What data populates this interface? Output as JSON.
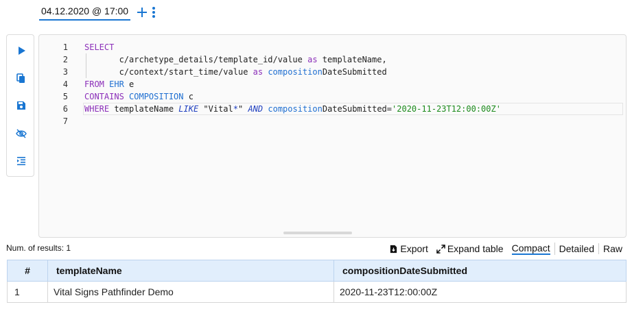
{
  "tab": {
    "label": "04.12.2020 @ 17:00"
  },
  "toolbar": {
    "icons": [
      "play-icon",
      "copy-icon",
      "save-icon",
      "eye-off-icon",
      "format-indent-icon"
    ]
  },
  "editor": {
    "line_numbers": [
      "1",
      "2",
      "3",
      "4",
      "5",
      "6",
      "7"
    ],
    "lines": [
      [
        {
          "t": "SELECT",
          "c": "kw"
        }
      ],
      [
        {
          "t": "       c/archetype_details/template_id/value ",
          "c": "plain"
        },
        {
          "t": "as",
          "c": "kw"
        },
        {
          "t": " templateName,",
          "c": "plain"
        }
      ],
      [
        {
          "t": "       c/context/start_time/value ",
          "c": "plain"
        },
        {
          "t": "as",
          "c": "kw"
        },
        {
          "t": " ",
          "c": "plain"
        },
        {
          "t": "composition",
          "c": "kwb"
        },
        {
          "t": "DateSubmitted",
          "c": "plain"
        }
      ],
      [
        {
          "t": "FROM",
          "c": "kw"
        },
        {
          "t": " ",
          "c": "plain"
        },
        {
          "t": "EHR",
          "c": "kwb"
        },
        {
          "t": " e",
          "c": "plain"
        }
      ],
      [
        {
          "t": "CONTAINS",
          "c": "kw"
        },
        {
          "t": " ",
          "c": "plain"
        },
        {
          "t": "COMPOSITION",
          "c": "kwb"
        },
        {
          "t": " c",
          "c": "plain"
        }
      ],
      [
        {
          "t": "WHERE",
          "c": "kw"
        },
        {
          "t": " templateName ",
          "c": "plain"
        },
        {
          "t": "LIKE",
          "c": "op"
        },
        {
          "t": " \"Vital",
          "c": "plain"
        },
        {
          "t": "*",
          "c": "op"
        },
        {
          "t": "\" ",
          "c": "plain"
        },
        {
          "t": "AND",
          "c": "op"
        },
        {
          "t": " ",
          "c": "plain"
        },
        {
          "t": "composition",
          "c": "kwb"
        },
        {
          "t": "DateSubmitted=",
          "c": "plain"
        },
        {
          "t": "'2020-11-23T12:00:00Z'",
          "c": "str"
        }
      ],
      []
    ]
  },
  "results": {
    "count_label": "Num. of results: 1",
    "actions": {
      "export": "Export",
      "expand": "Expand table",
      "compact": "Compact",
      "detailed": "Detailed",
      "raw": "Raw"
    },
    "columns": [
      "#",
      "templateName",
      "compositionDateSubmitted"
    ],
    "rows": [
      [
        "1",
        "Vital Signs Pathfinder Demo",
        "2020-11-23T12:00:00Z"
      ]
    ]
  },
  "colors": {
    "accent": "#1976d2",
    "keyword": "#8b2fb9",
    "builtin": "#1f6fd1",
    "string": "#1b8a1b",
    "header_bg": "#e1eefc"
  }
}
